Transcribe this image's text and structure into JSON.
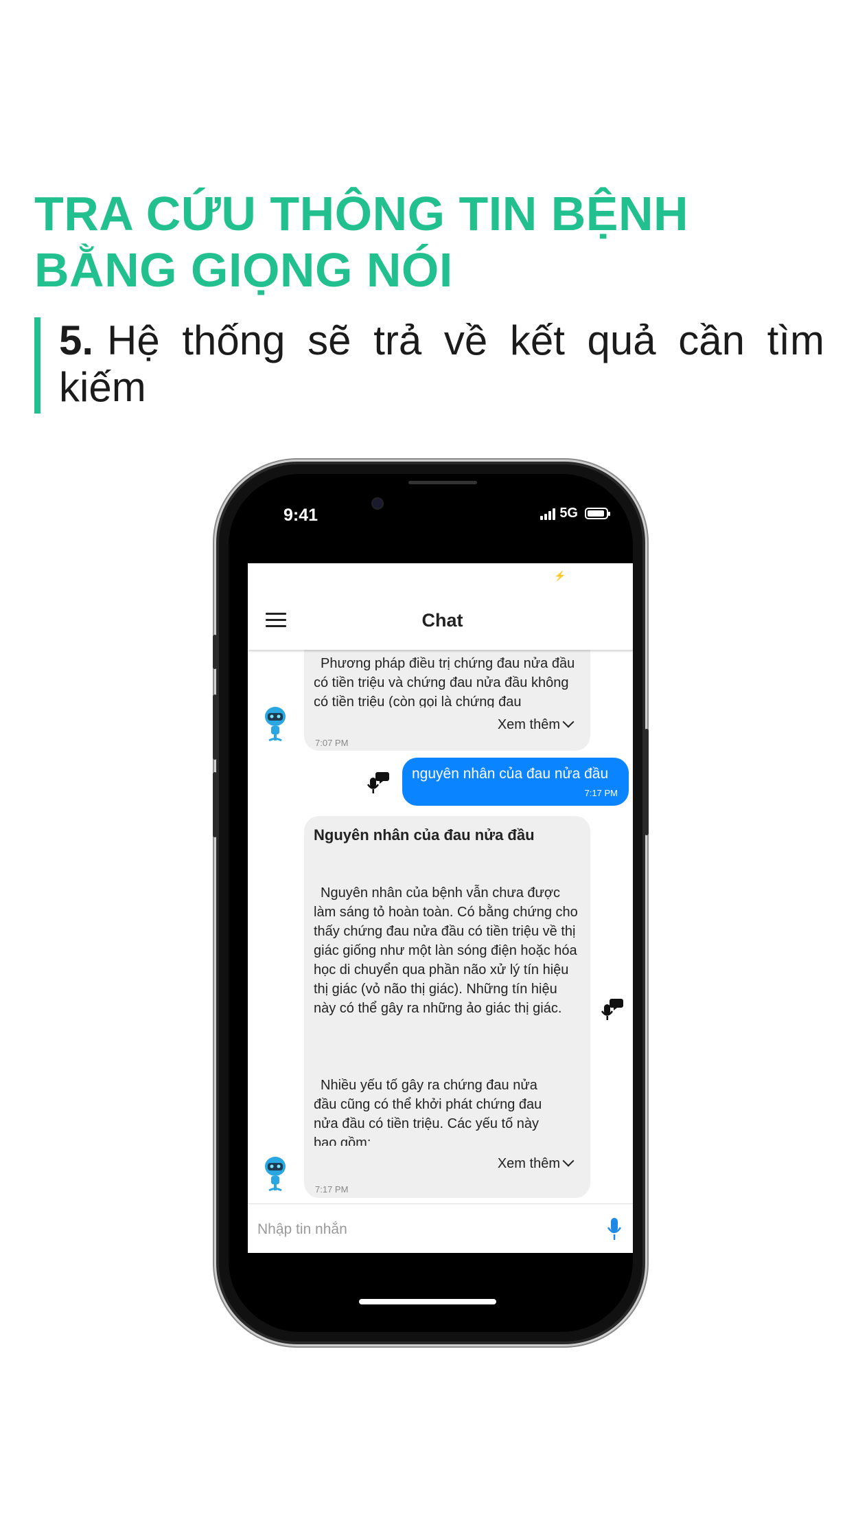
{
  "page": {
    "title": "TRA CỨU THÔNG TIN BỆNH BẰNG GIỌNG NÓI",
    "step_number": "5.",
    "step_text": "Hệ thống sẽ trả về kết quả cần tìm kiếm"
  },
  "colors": {
    "accent": "#23c08f",
    "user_bubble": "#0a84ff",
    "bot_bubble": "#efefef"
  },
  "status_bar": {
    "time": "9:41",
    "network": "5G"
  },
  "app": {
    "title": "Chat"
  },
  "messages": [
    {
      "sender": "bot",
      "text": "Phương pháp điều trị chứng đau nửa đầu có tiền triệu và chứng đau nửa đầu không có tiền triệu (còn gọi là chứng đau",
      "see_more": "Xem thêm",
      "time": "7:07 PM"
    },
    {
      "sender": "user",
      "text": "nguyên nhân của đau nửa đầu",
      "time": "7:17 PM"
    },
    {
      "sender": "bot",
      "title": "Nguyên nhân của đau nửa đầu",
      "paragraph1": "Nguyên nhân của bệnh vẫn chưa được làm sáng tỏ hoàn toàn. Có bằng chứng cho thấy chứng đau nửa đầu có tiền triệu về thị giác giống như một làn sóng điện hoặc hóa học di chuyển qua phần não xử lý tín hiệu thị giác (vỏ não thị giác). Những tín hiệu này có thể gây ra những ảo giác thị giác.",
      "paragraph2": "Nhiều yếu tố gây ra chứng đau nửa đầu cũng có thể khởi phát chứng đau nửa đầu có tiền triệu. Các yếu tố này bao gồm:",
      "see_more": "Xem thêm",
      "time": "7:17 PM"
    }
  ],
  "input": {
    "placeholder": "Nhập tin nhắn"
  },
  "icons": {
    "menu": "hamburger-menu-icon",
    "bot_avatar": "robot-avatar-icon",
    "voice_message": "voice-message-icon",
    "mic": "microphone-icon"
  }
}
